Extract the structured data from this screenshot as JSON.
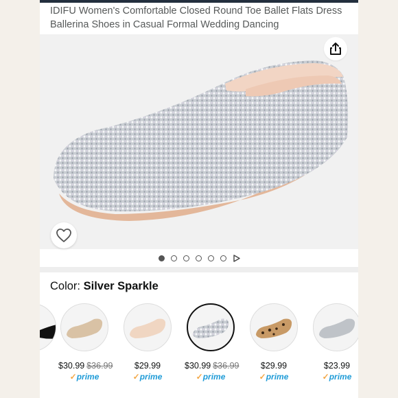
{
  "header": {
    "title": "IDIFU Women's Comfortable Closed Round Toe Ballet Flats Dress Ballerina Shoes in Casual Formal Wedding Dancing"
  },
  "gallery": {
    "image": "silver-rhinestone-ballet-flat",
    "share_icon": "share-icon",
    "wishlist_icon": "heart-icon",
    "dot_count": 6,
    "active_dot": 1,
    "play_icon": "play-icon"
  },
  "color": {
    "label": "Color: ",
    "value": "Silver Sparkle"
  },
  "swatches": [
    {
      "name": "champagne",
      "price": "$30.99",
      "strike": "$36.99",
      "prime": "prime",
      "selected": false
    },
    {
      "name": "nude",
      "price": "$29.99",
      "strike": "",
      "prime": "prime",
      "selected": false
    },
    {
      "name": "silver-sparkle",
      "price": "$30.99",
      "strike": "$36.99",
      "prime": "prime",
      "selected": true
    },
    {
      "name": "leopard",
      "price": "$29.99",
      "strike": "",
      "prime": "prime",
      "selected": false
    },
    {
      "name": "silver",
      "price": "$23.99",
      "strike": "",
      "prime": "prime",
      "selected": false
    }
  ],
  "colors": {
    "accent": "#1e9bd7",
    "prime_check": "#f3a847",
    "topbar": "#232f3e"
  }
}
